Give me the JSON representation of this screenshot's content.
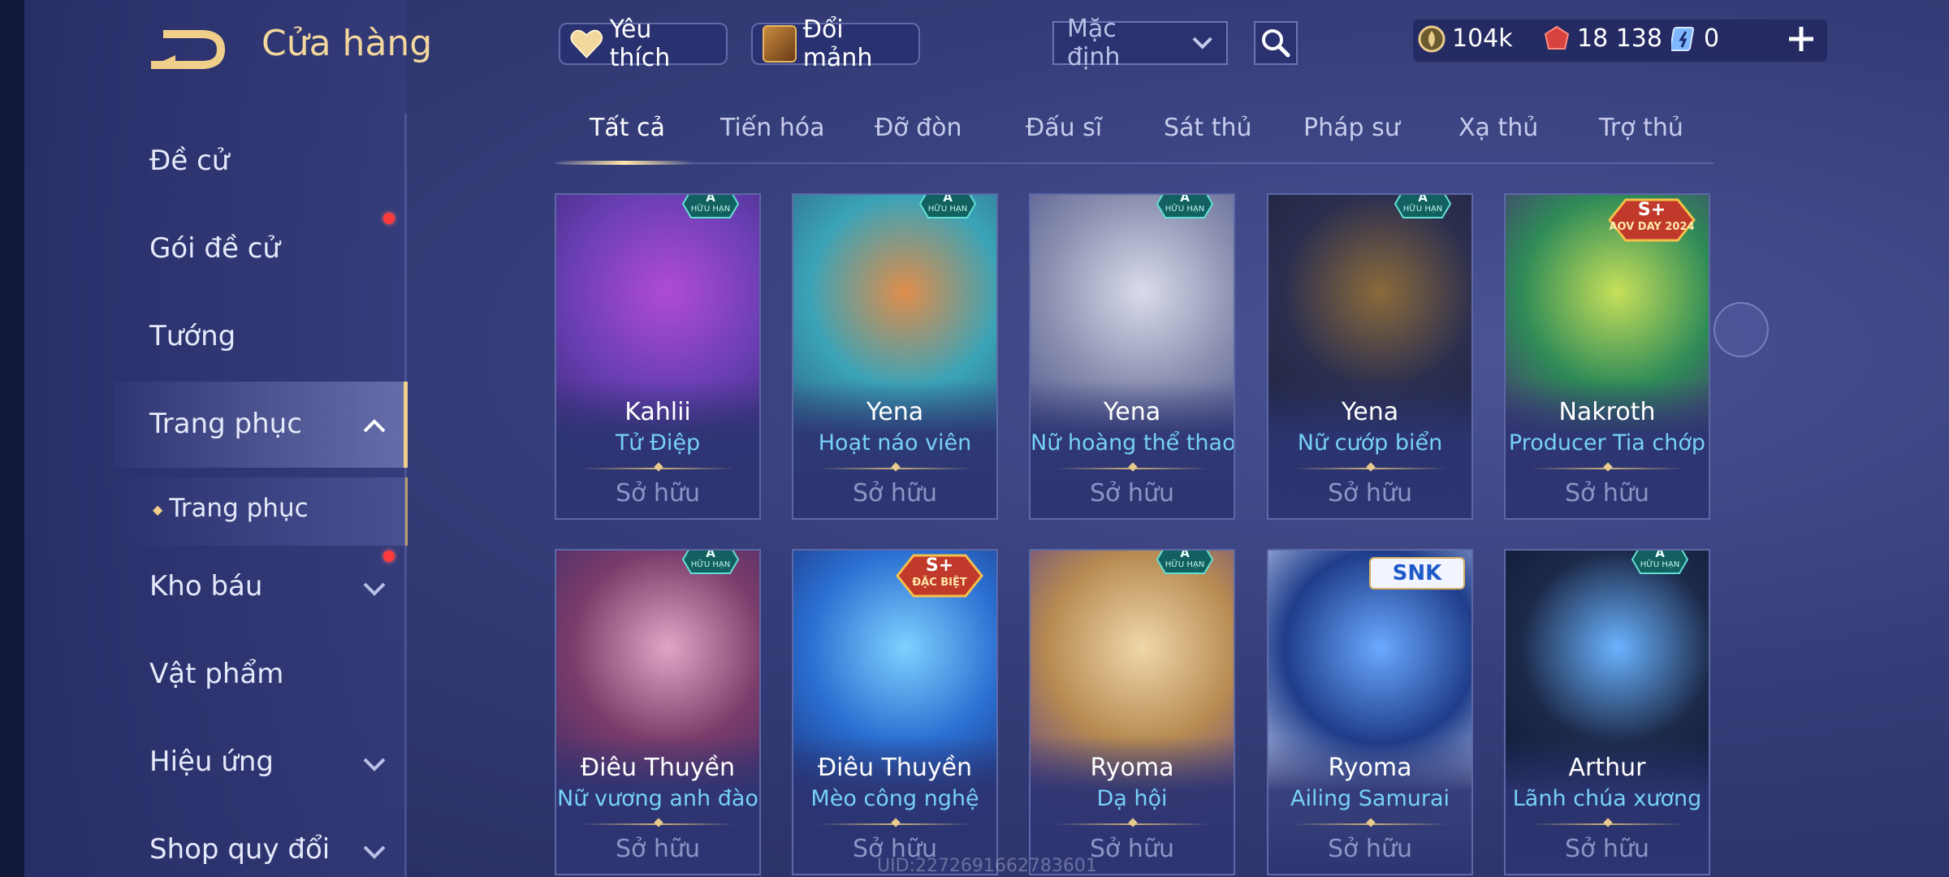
{
  "header": {
    "title": "Cửa hàng",
    "favorites_label": "Yêu thích",
    "fragments_label": "Đổi mảnh",
    "sort": {
      "selected": "Mặc định"
    },
    "currencies": {
      "gold": "104k",
      "voucher": "18 138",
      "ticket": "0"
    }
  },
  "tabs": [
    "Tất cả",
    "Tiến hóa",
    "Đỡ đòn",
    "Đấu sĩ",
    "Sát thủ",
    "Pháp sư",
    "Xạ thủ",
    "Trợ thủ"
  ],
  "sidebar": {
    "items": [
      {
        "label": "Đề cử"
      },
      {
        "label": "Gói đề cử"
      },
      {
        "label": "Tướng"
      },
      {
        "label": "Trang phục"
      },
      {
        "label": "Trang phục"
      },
      {
        "label": "Kho báu"
      },
      {
        "label": "Vật phẩm"
      },
      {
        "label": "Hiệu ứng"
      },
      {
        "label": "Shop quy đổi"
      }
    ]
  },
  "cards": [
    {
      "hero": "Kahlii",
      "skin": "Tử Điệp",
      "status": "Sở hữu",
      "badge": "A",
      "badge_sub": "HỮU HẠN"
    },
    {
      "hero": "Yena",
      "skin": "Hoạt náo viên",
      "status": "Sở hữu",
      "badge": "A",
      "badge_sub": "HỮU HẠN"
    },
    {
      "hero": "Yena",
      "skin": "Nữ hoàng thể thao",
      "status": "Sở hữu",
      "badge": "A",
      "badge_sub": "HỮU HẠN"
    },
    {
      "hero": "Yena",
      "skin": "Nữ cướp biển",
      "status": "Sở hữu",
      "badge": "A",
      "badge_sub": "HỮU HẠN"
    },
    {
      "hero": "Nakroth",
      "skin": "Producer Tia chớp",
      "status": "Sở hữu",
      "badge": "S+",
      "badge_sub": "AOV DAY 2024"
    },
    {
      "hero": "Điêu Thuyền",
      "skin": "Nữ vương anh đào",
      "status": "Sở hữu",
      "badge": "A",
      "badge_sub": "HỮU HẠN"
    },
    {
      "hero": "Điêu Thuyền",
      "skin": "Mèo công nghệ",
      "status": "Sở hữu",
      "badge": "S+",
      "badge_sub": "ĐẶC BIỆT"
    },
    {
      "hero": "Ryoma",
      "skin": "Dạ hội",
      "status": "Sở hữu",
      "badge": "A",
      "badge_sub": "HỮU HẠN"
    },
    {
      "hero": "Ryoma",
      "skin": "Ailing Samurai",
      "status": "Sở hữu",
      "badge": "SNK",
      "badge_sub": ""
    },
    {
      "hero": "Arthur",
      "skin": "Lãnh chúa xương",
      "status": "Sở hữu",
      "badge": "A",
      "badge_sub": "HỮU HẠN"
    }
  ],
  "footer": {
    "uid": "UID:2272691662783601"
  },
  "colors": {
    "accent_gold": "#f3d79c",
    "skin_name": "#76d1f7",
    "notification": "#ff3b3b"
  }
}
